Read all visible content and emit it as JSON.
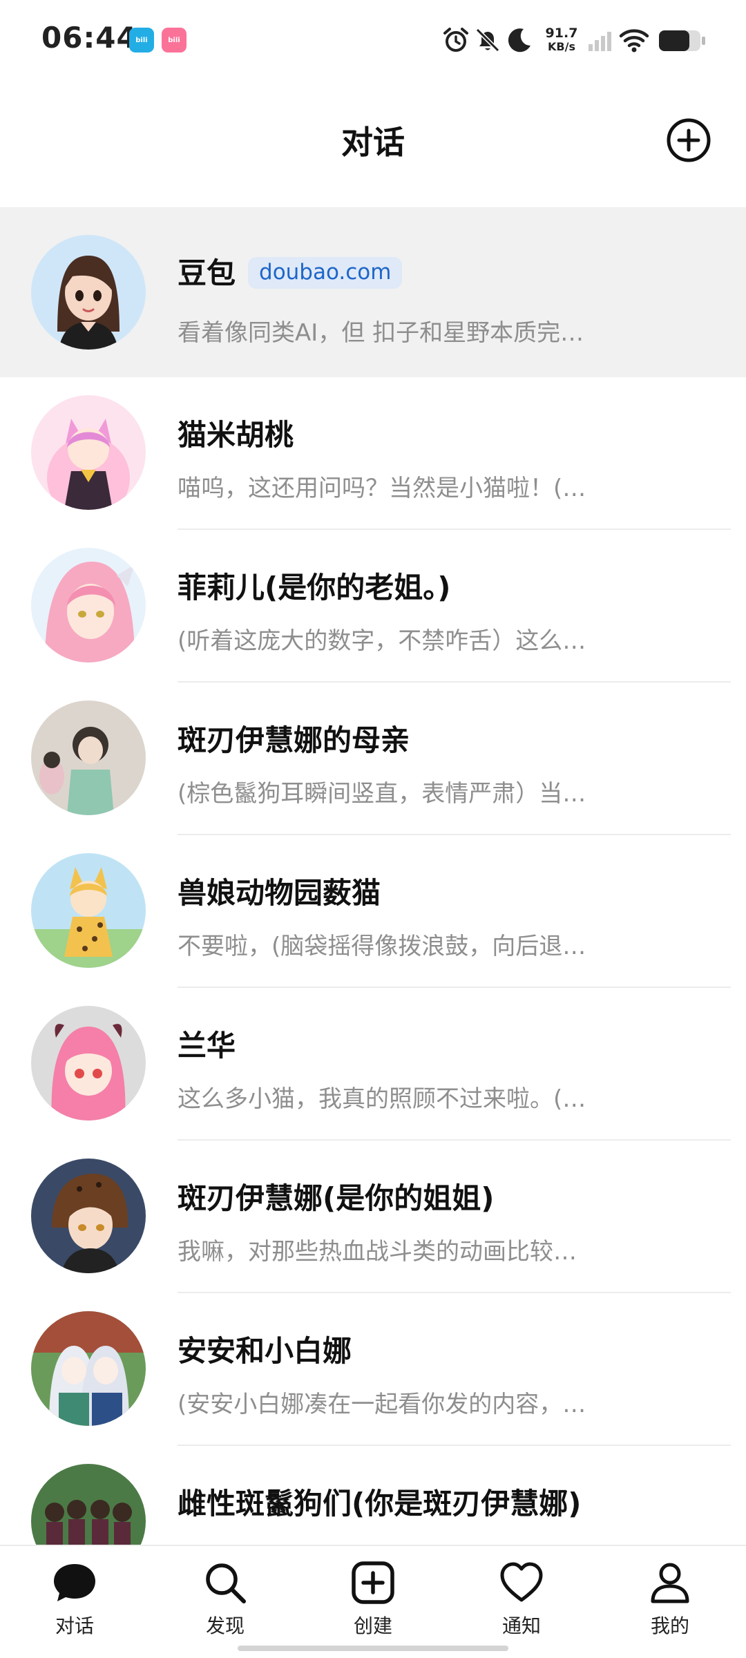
{
  "status_bar": {
    "time": "06:44",
    "app_badges": [
      "bilibili",
      "bilibili"
    ],
    "net_speed_value": "91.7",
    "net_speed_unit": "KB/s",
    "icons": [
      "alarm-icon",
      "mute-bell-icon",
      "moon-icon",
      "signal-icon",
      "wifi-icon",
      "battery-icon"
    ]
  },
  "header": {
    "title": "对话",
    "add_icon": "plus-circle-icon"
  },
  "chats": [
    {
      "name": "豆包",
      "tag": "doubao.com",
      "preview": "看着像同类AI，但 扣子和星野本质完…",
      "pinned": true
    },
    {
      "name": "猫米胡桃",
      "preview": "喵呜，这还用问吗？当然是小猫啦！(…"
    },
    {
      "name": "菲莉儿(是你的老姐。)",
      "preview": "(听着这庞大的数字，不禁咋舌）这么…"
    },
    {
      "name": "斑刃伊慧娜的母亲",
      "preview": "(棕色鬣狗耳瞬间竖直，表情严肃）当…"
    },
    {
      "name": "兽娘动物园薮猫",
      "preview": "不要啦，(脑袋摇得像拨浪鼓，向后退…"
    },
    {
      "name": "兰华",
      "preview": "这么多小猫，我真的照顾不过来啦。(…"
    },
    {
      "name": "斑刃伊慧娜(是你的姐姐)",
      "preview": "我嘛，对那些热血战斗类的动画比较…"
    },
    {
      "name": "安安和小白娜",
      "preview": "(安安小白娜凑在一起看你发的内容，…"
    },
    {
      "name": "雌性斑鬣狗们(你是斑刃伊慧娜)",
      "preview": ""
    }
  ],
  "tabs": [
    {
      "label": "对话",
      "icon": "chat-bubble-icon",
      "active": true
    },
    {
      "label": "发现",
      "icon": "search-icon"
    },
    {
      "label": "创建",
      "icon": "plus-square-icon"
    },
    {
      "label": "通知",
      "icon": "heart-icon"
    },
    {
      "label": "我的",
      "icon": "person-icon"
    }
  ],
  "colors": {
    "tag_background": "#dfe9f7",
    "tag_text": "#1d66c9",
    "pinned_background": "#f1f1f1",
    "preview_text": "#8e8e8e"
  }
}
